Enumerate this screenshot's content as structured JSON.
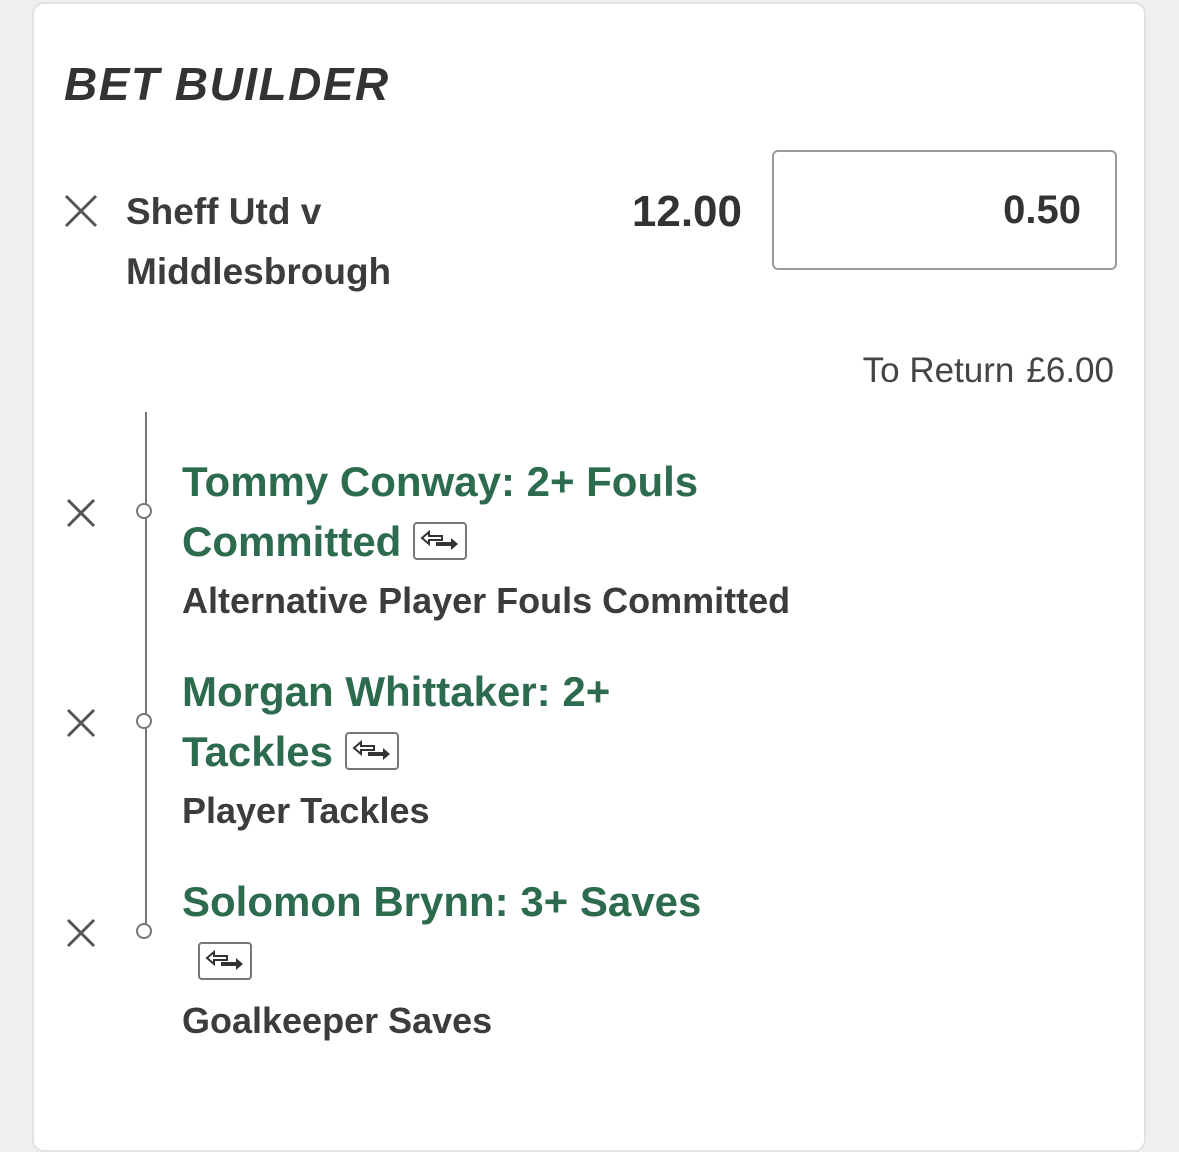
{
  "bet_builder": {
    "title": "BET BUILDER",
    "match": "Sheff Utd v Middlesbrough",
    "odds": "12.00",
    "stake": "0.50",
    "to_return_label": "To Return",
    "to_return_amount": "£6.00",
    "selections": [
      {
        "title": "Tommy Conway: 2+ Fouls Committed",
        "market": "Alternative Player Fouls Committed"
      },
      {
        "title": "Morgan Whittaker: 2+ Tackles",
        "market": "Player Tackles"
      },
      {
        "title": "Solomon Brynn: 3+ Saves",
        "market": "Goalkeeper Saves"
      }
    ]
  },
  "icons": {
    "remove": "close-icon",
    "swap": "swap-icon"
  },
  "colors": {
    "selection_green": "#2d6b4e",
    "text_dark": "#333333",
    "timeline_gray": "#777777"
  }
}
